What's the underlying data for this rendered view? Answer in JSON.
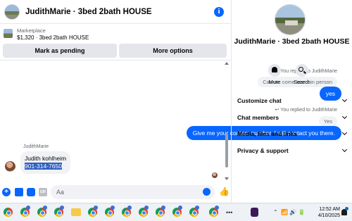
{
  "chat": {
    "title": "JudithMarie · 3bed 2bath HOUSE",
    "marketplace_label": "Marketplace",
    "listing": "$1,320 · 3bed 2bath HOUSE",
    "mark_pending_label": "Mark as pending",
    "more_options_label": "More options",
    "messages": {
      "replied_label": "You replied to JudithMarie",
      "quoted_1": "Can we come see it in person",
      "outgoing_1": "yes",
      "quoted_2": "Yes",
      "outgoing_2": "Give me your contact number, I will contact you there.",
      "sender_name": "JudithMarie",
      "incoming_name": "Judith kohlheim",
      "incoming_phone": "901-314-7650"
    },
    "composer_placeholder": "Aa"
  },
  "info_panel": {
    "name": "JudithMarie · 3bed 2bath HOUSE",
    "mute_label": "Mute",
    "search_label": "Search",
    "sections": [
      "Customize chat",
      "Chat members",
      "Media, files and links",
      "Privacy & support"
    ]
  },
  "taskbar": {
    "time": "12:52 AM",
    "date": "4/10/2025"
  },
  "colors": {
    "accent": "#0866ff",
    "bubble_in": "#f0f2f5",
    "selection": "#2f5fbf"
  }
}
